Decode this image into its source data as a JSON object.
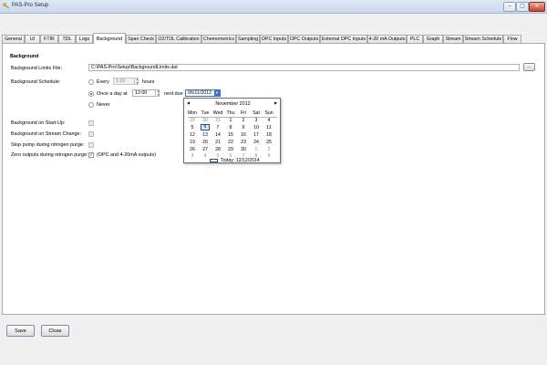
{
  "window": {
    "title": "PAS-Pro Setup",
    "minimize": "–",
    "maximize": "▢",
    "close": "✕"
  },
  "tabs": [
    {
      "label": "General"
    },
    {
      "label": "UI"
    },
    {
      "label": "FTIR"
    },
    {
      "label": "TDL"
    },
    {
      "label": "Logs"
    },
    {
      "label": "Background",
      "active": true
    },
    {
      "label": "Span Check"
    },
    {
      "label": "O2/TDL Calibration"
    },
    {
      "label": "Chemometrics"
    },
    {
      "label": "Sampling"
    },
    {
      "label": "OPC Inputs"
    },
    {
      "label": "OPC Outputs"
    },
    {
      "label": "External OPC Inputs"
    },
    {
      "label": "4-20 mA Outputs"
    },
    {
      "label": "PLC"
    },
    {
      "label": "Graph"
    },
    {
      "label": "Stream"
    },
    {
      "label": "Stream Schedule"
    },
    {
      "label": "Flow"
    }
  ],
  "background": {
    "section_title": "Background",
    "limits_file_label": "Background Limits File:",
    "limits_file_value": "C:\\PAS-Pro\\Setup\\BackgroundLimits.dat",
    "browse_label": "...",
    "schedule_label": "Background Schedule:",
    "every_label": "Every",
    "every_value": "1.00",
    "hours_label": "hours",
    "once_label": "Once a day at",
    "once_time": "12:00",
    "next_due_label": "next due",
    "next_due_value": "06/11/2012",
    "never_label": "Never",
    "on_startup_label": "Background on Start-Up:",
    "on_stream_change_label": "Background on Stream Change:",
    "stop_pump_label": "Stop pump during nitrogen purge:",
    "zero_outputs_label": "Zero outputs during nitrogen purge:",
    "zero_outputs_note": "(OPC and 4-20mA outputs)",
    "zero_outputs_checked": "✓"
  },
  "calendar": {
    "month_label": "November 2012",
    "prev": "◀",
    "next": "▶",
    "weekdays": [
      "Mon",
      "Tue",
      "Wed",
      "Thu",
      "Fri",
      "Sat",
      "Sun"
    ],
    "weeks": [
      [
        "29",
        "30",
        "31",
        "1",
        "2",
        "3",
        "4"
      ],
      [
        "5",
        "6",
        "7",
        "8",
        "9",
        "10",
        "11"
      ],
      [
        "12",
        "13",
        "14",
        "15",
        "16",
        "17",
        "18"
      ],
      [
        "19",
        "20",
        "21",
        "22",
        "23",
        "24",
        "25"
      ],
      [
        "26",
        "27",
        "28",
        "29",
        "30",
        "1",
        "2"
      ],
      [
        "3",
        "4",
        "5",
        "6",
        "7",
        "8",
        "9"
      ]
    ],
    "today_label": "Today: 12/12/2014"
  },
  "footer": {
    "save_label": "Save",
    "close_label": "Close"
  }
}
